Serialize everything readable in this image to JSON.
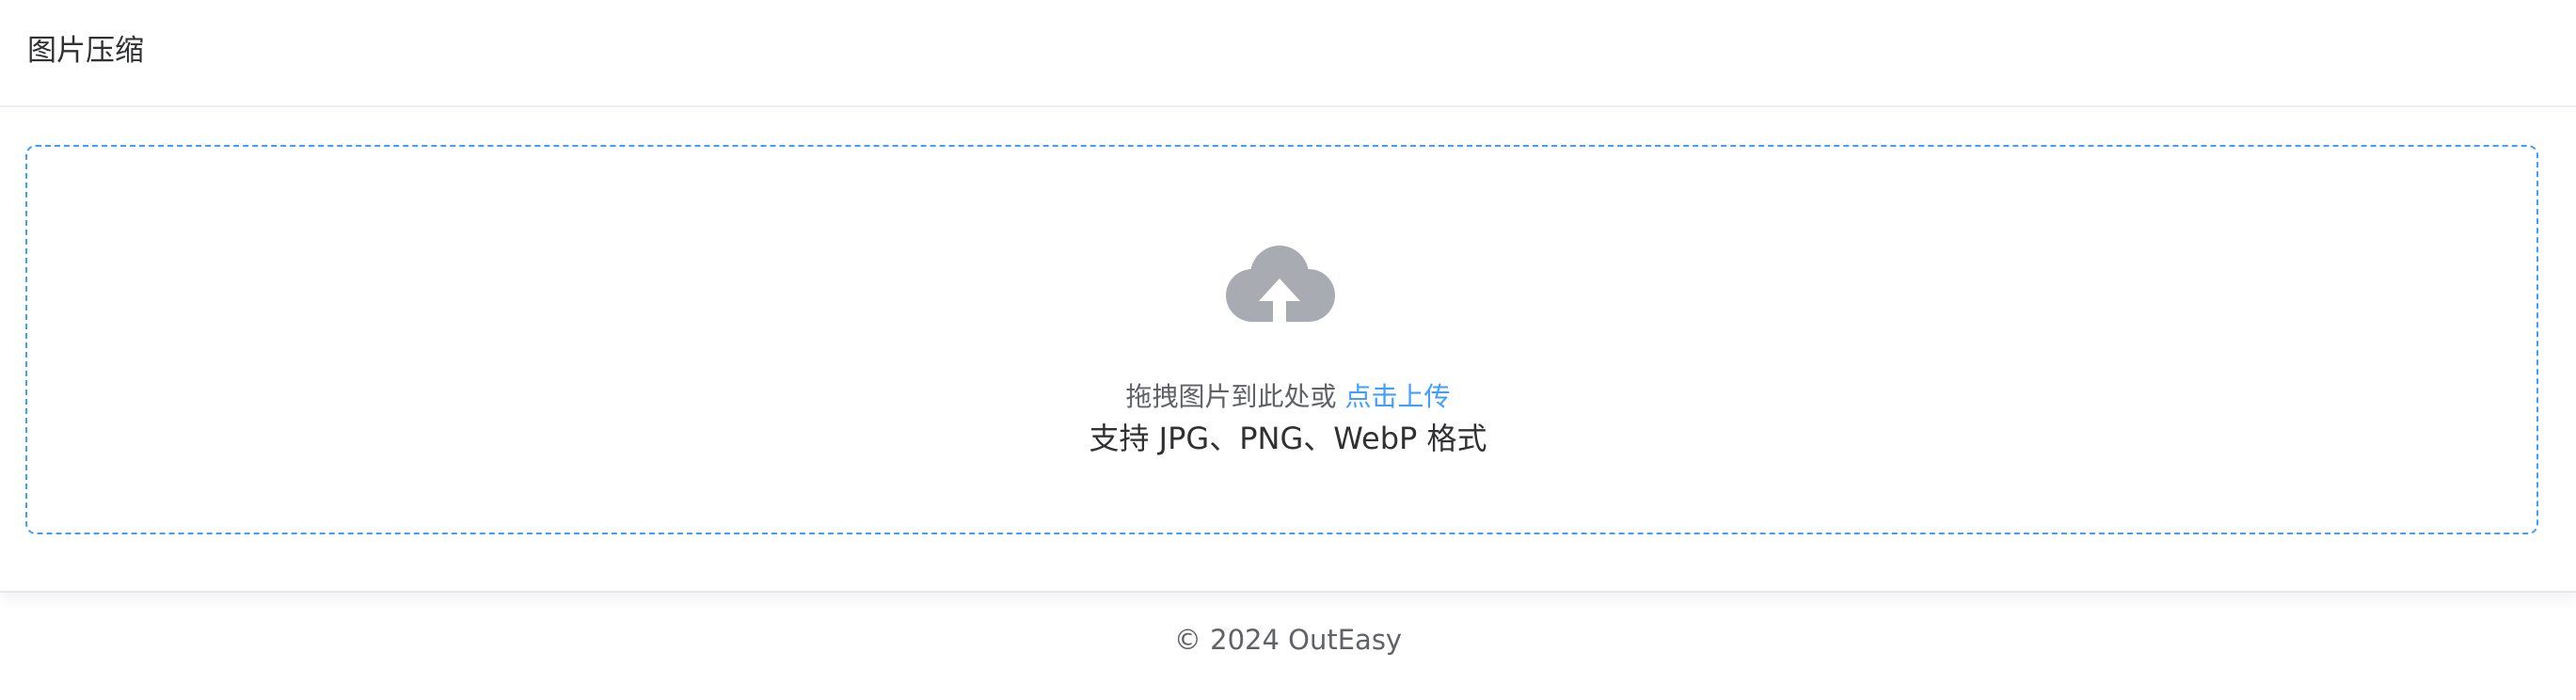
{
  "card": {
    "title": "图片压缩"
  },
  "upload": {
    "icon": "cloud-upload-icon",
    "prompt": "拖拽图片到此处或",
    "link": "点击上传",
    "formats": "支持 JPG、PNG、WebP 格式",
    "accent_color": "#409eff",
    "icon_color": "#a8abb2"
  },
  "footer": {
    "copyright": "© 2024 OutEasy"
  }
}
